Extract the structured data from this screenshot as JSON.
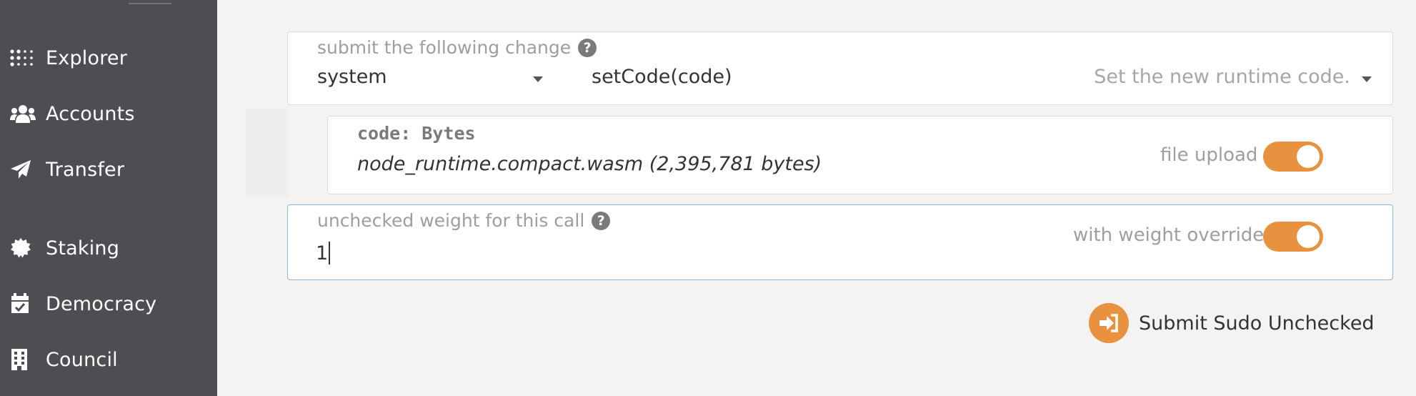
{
  "sidebar": {
    "items": [
      {
        "label": "Explorer",
        "icon": "grid-dots-icon"
      },
      {
        "label": "Accounts",
        "icon": "users-icon"
      },
      {
        "label": "Transfer",
        "icon": "paper-plane-icon"
      },
      {
        "label": "Staking",
        "icon": "certificate-icon"
      },
      {
        "label": "Democracy",
        "icon": "calendar-check-icon"
      },
      {
        "label": "Council",
        "icon": "building-icon"
      }
    ]
  },
  "call": {
    "label": "submit the following change",
    "module": "system",
    "method": "setCode(code)",
    "method_description": "Set the new runtime code."
  },
  "param": {
    "label": "code: Bytes",
    "value": "node_runtime.compact.wasm (2,395,781 bytes)",
    "toggle_label": "file upload",
    "toggle_on": true
  },
  "weight": {
    "label": "unchecked weight for this call",
    "value": "1",
    "toggle_label": "with weight override",
    "toggle_on": true
  },
  "submit": {
    "label": "Submit Sudo Unchecked"
  },
  "colors": {
    "accent": "#e8913f",
    "sidebar_bg": "#4d4e51",
    "page_bg": "#f4f3f1",
    "focus_border": "#8fb6d6"
  }
}
